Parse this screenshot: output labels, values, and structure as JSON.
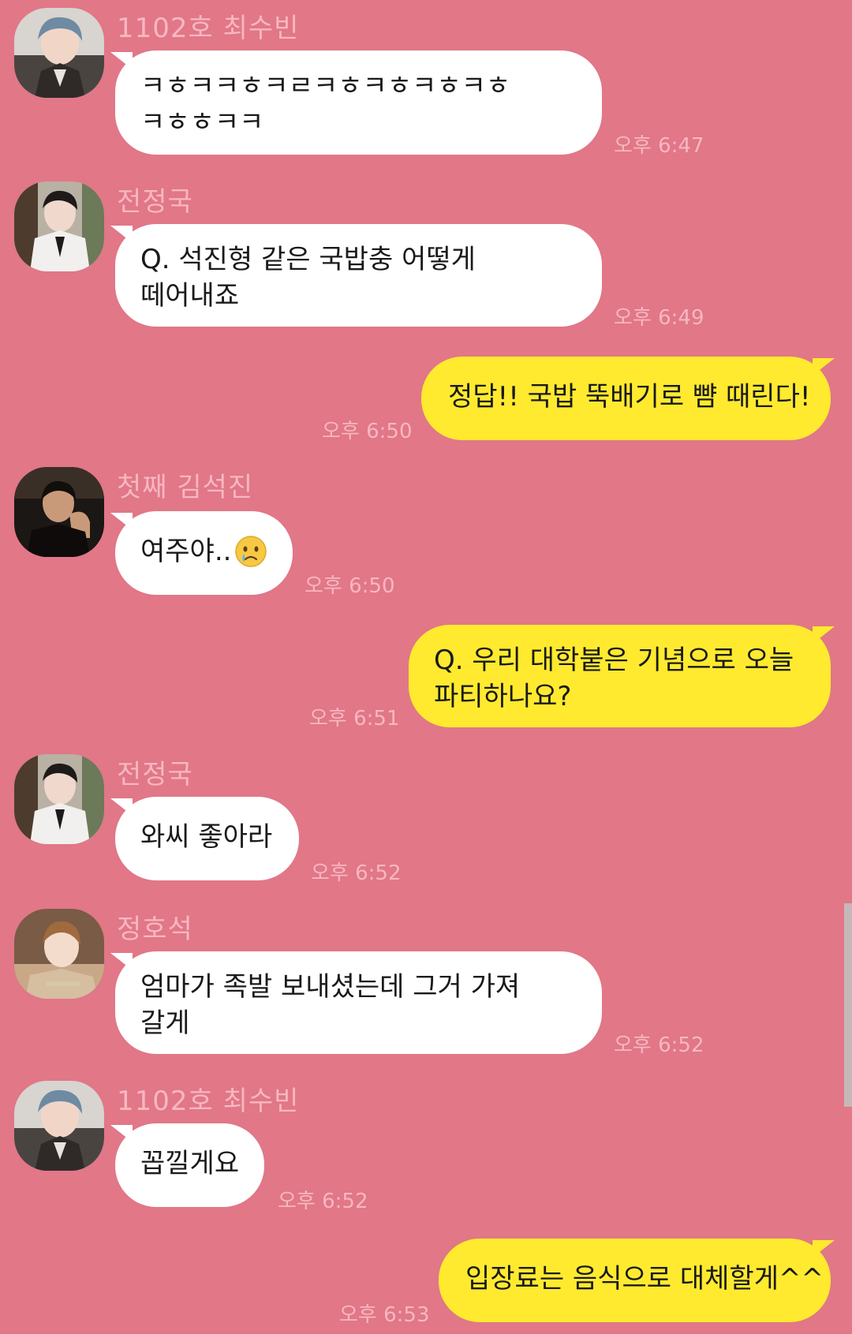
{
  "messages": [
    {
      "sender": "1102호 최수빈",
      "avatar": "avatar-soobin",
      "lines": [
        "ㅋㅎㅋㅋㅎㅋㄹㅋㅎㅋㅎㅋㅎㅋㅎ",
        "ㅋㅎㅎㅋㅋ"
      ],
      "time": "오후 6:47"
    },
    {
      "sender": "전정국",
      "avatar": "avatar-jungkook",
      "lines": [
        "Q. 석진형 같은 국밥충 어떻게",
        "떼어내죠"
      ],
      "time": "오후 6:49"
    },
    {
      "outgoing": true,
      "lines": [
        "정답!! 국밥 뚝배기로 뺨 때린다!"
      ],
      "time": "오후 6:50"
    },
    {
      "sender": "첫째 김석진",
      "avatar": "avatar-seokjin",
      "lines": [
        "여주야.."
      ],
      "emoji": "crying-face-emoji",
      "time": "오후 6:50"
    },
    {
      "outgoing": true,
      "lines": [
        "Q. 우리 대학붙은 기념으로 오늘",
        "파티하나요?"
      ],
      "time": "오후 6:51"
    },
    {
      "sender": "전정국",
      "avatar": "avatar-jungkook",
      "lines": [
        "와씨 좋아라"
      ],
      "time": "오후 6:52"
    },
    {
      "sender": "정호석",
      "avatar": "avatar-hoseok",
      "lines": [
        "엄마가 족발 보내셨는데 그거 가져",
        "갈게"
      ],
      "time": "오후 6:52"
    },
    {
      "sender": "1102호 최수빈",
      "avatar": "avatar-soobin",
      "lines": [
        "꼽낄게요"
      ],
      "time": "오후 6:52"
    },
    {
      "outgoing": true,
      "lines": [
        "입장료는 음식으로 대체할게^^"
      ],
      "time": "오후 6:53"
    }
  ],
  "colors": {
    "background": "#e17787",
    "incoming_bubble": "#ffffff",
    "outgoing_bubble": "#ffea2f",
    "meta_text": "#f7b7c1"
  }
}
